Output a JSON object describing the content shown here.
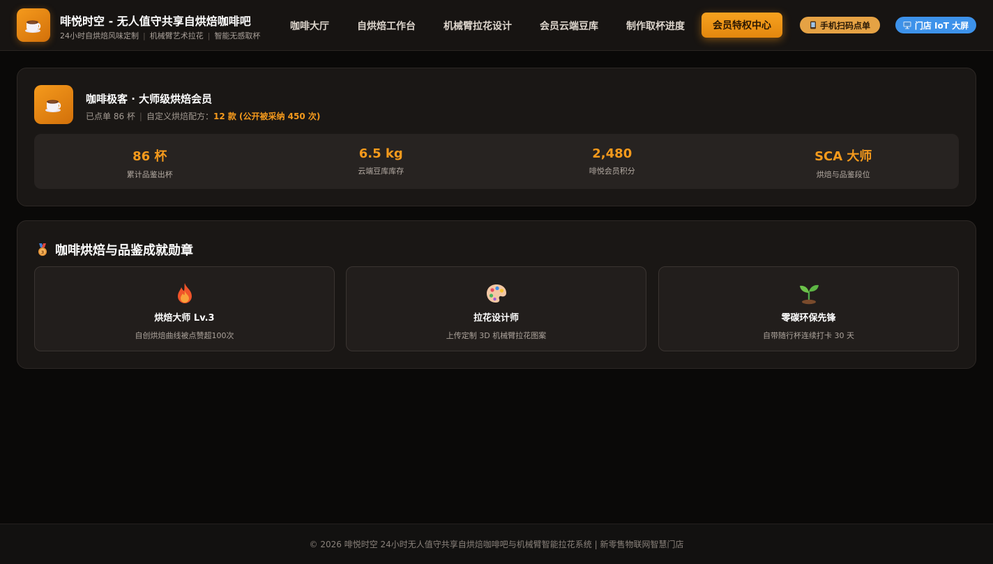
{
  "brand": {
    "title": "啡悦时空 - 无人值守共享自烘焙咖啡吧",
    "sub_1": "24小时自烘焙风味定制",
    "sub_2": "机械臂艺术拉花",
    "sub_3": "智能无感取杯",
    "logo_icon": "coffee-cup-icon"
  },
  "nav": {
    "items": [
      "咖啡大厅",
      "自烘焙工作台",
      "机械臂拉花设计",
      "会员云端豆库",
      "制作取杯进度"
    ],
    "active": "会员特权中心",
    "scan_button": "手机扫码点单",
    "iot_button": "门店 IoT 大屏",
    "scan_icon": "phone-icon",
    "iot_icon": "screen-icon"
  },
  "profile": {
    "avatar_icon": "coffee-cup-icon",
    "title": "咖啡极客 · 大师级烘焙会员",
    "orders": "已点单 86 杯",
    "recipes_label": "自定义烘焙配方：",
    "recipes_value": "12 款 (公开被采纳 450 次)",
    "stats": [
      {
        "value": "86 杯",
        "label": "累计品鉴出杯"
      },
      {
        "value": "6.5 kg",
        "label": "云端豆库库存"
      },
      {
        "value": "2,480",
        "label": "啡悦会员积分"
      },
      {
        "value": "SCA 大师",
        "label": "烘焙与品鉴段位"
      }
    ]
  },
  "badges": {
    "title": "咖啡烘焙与品鉴成就勋章",
    "title_icon": "medal-icon",
    "items": [
      {
        "icon": "flame-icon",
        "name": "烘焙大师 Lv.3",
        "desc": "自创烘焙曲线被点赞超100次"
      },
      {
        "icon": "palette-icon",
        "name": "拉花设计师",
        "desc": "上传定制 3D 机械臂拉花图案"
      },
      {
        "icon": "seedling-icon",
        "name": "零碳环保先锋",
        "desc": "自带随行杯连续打卡 30 天"
      }
    ]
  },
  "footer": {
    "text": "© 2026 啡悦时空 24小时无人值守共享自烘焙咖啡吧与机械臂智能拉花系统 | 新零售物联网智慧门店"
  },
  "colors": {
    "accent": "#f59a1c",
    "background": "#0a0908",
    "card": "#1a1715",
    "iot_blue": "#3d92ea"
  }
}
